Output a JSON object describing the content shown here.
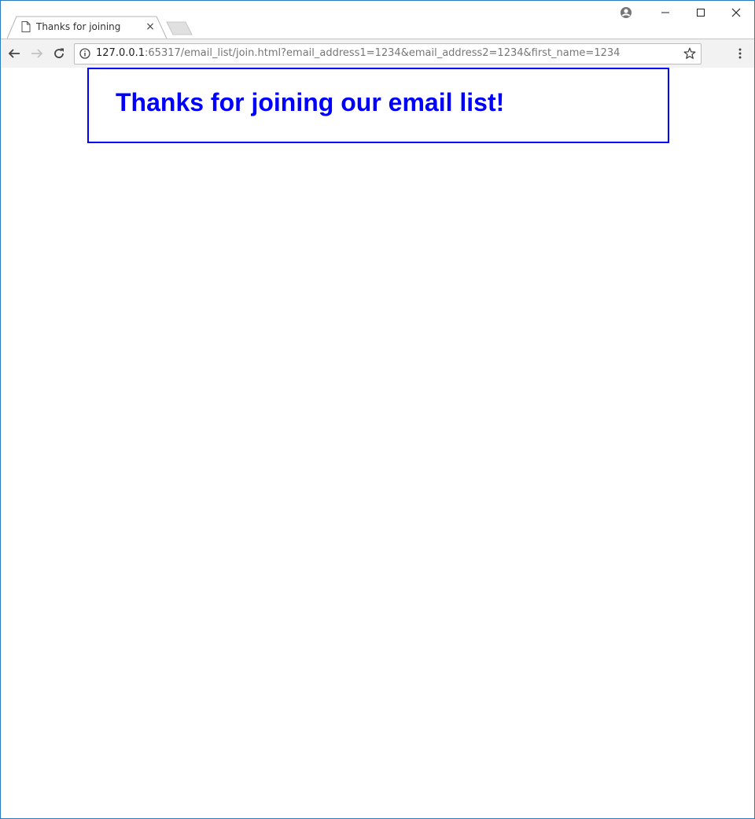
{
  "browser": {
    "tab": {
      "title": "Thanks for joining",
      "close_glyph": "×",
      "icon": "page-icon"
    },
    "address": {
      "host": "127.0.0.1",
      "rest": ":65317/email_list/join.html?email_address1=1234&email_address2=1234&first_name=1234"
    },
    "icons": [
      "back-arrow-icon",
      "forward-arrow-icon",
      "reload-icon",
      "info-icon",
      "star-icon",
      "menu-dots-icon",
      "profile-icon",
      "minimize-icon",
      "maximize-icon",
      "close-icon"
    ]
  },
  "page": {
    "heading": "Thanks for joining our email list!",
    "accent_color": "#0000ff"
  }
}
